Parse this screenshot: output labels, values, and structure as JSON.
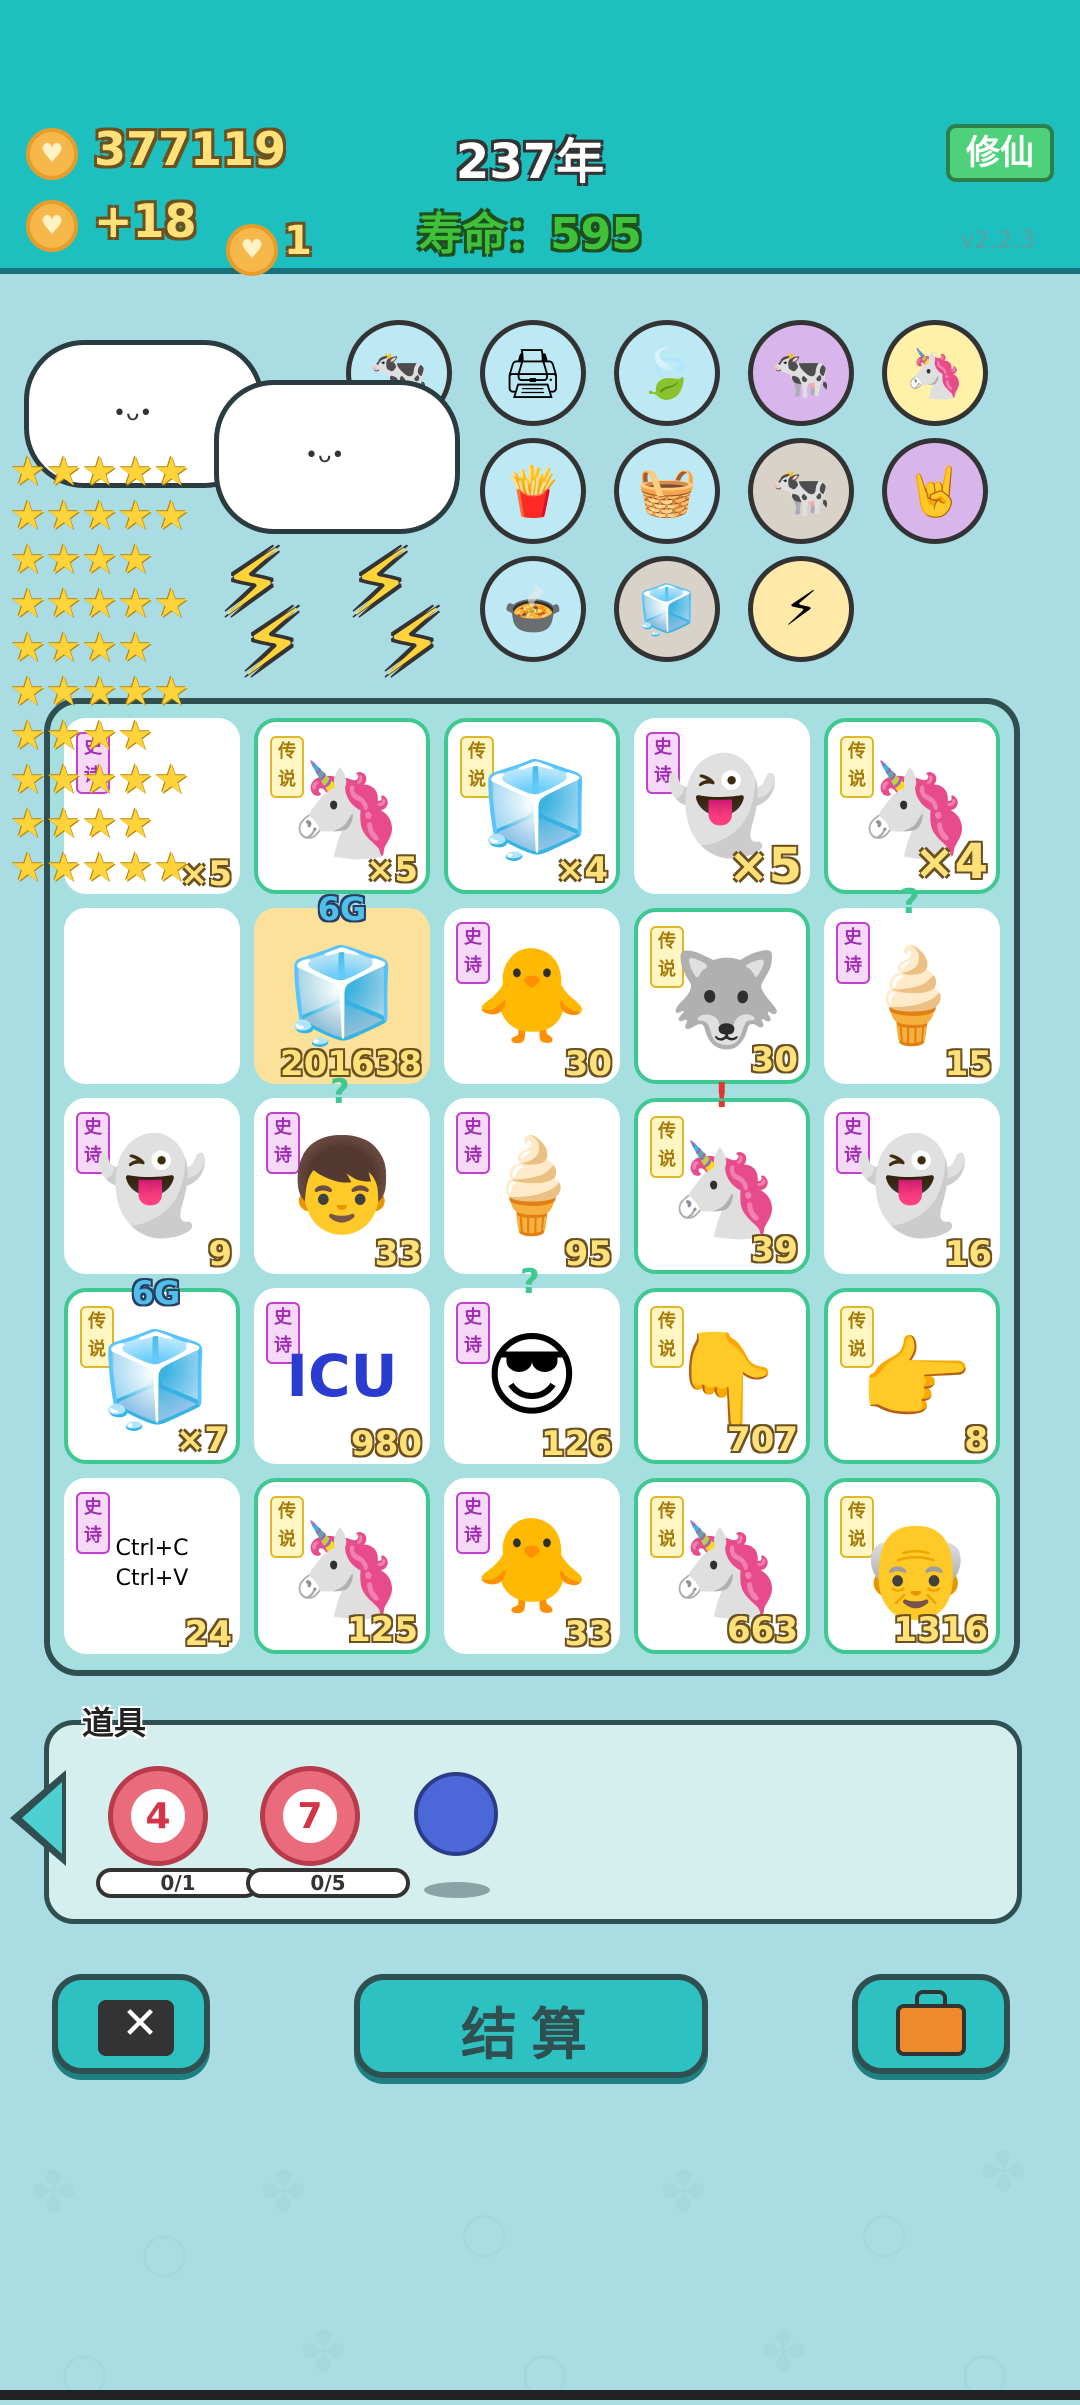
{
  "header": {
    "coins": "377119",
    "income": "+18",
    "floating_coin": "1",
    "year": "237年",
    "life_label": "寿命：",
    "life_value": "595",
    "xiuxian_button": "修仙",
    "version": "v2.2.3"
  },
  "shelf": {
    "symbols": [
      {
        "name": "printer",
        "glyph": "🖨"
      },
      {
        "name": "leaf",
        "glyph": "🍃"
      },
      {
        "name": "cows",
        "glyph": "🐄"
      },
      {
        "name": "unicorn",
        "glyph": "🦄"
      },
      {
        "name": "fries",
        "glyph": "🍟"
      },
      {
        "name": "fruit-basket",
        "glyph": "🧺"
      },
      {
        "name": "cows-2",
        "glyph": "🐄"
      },
      {
        "name": "rock-hand",
        "glyph": "🤘"
      },
      {
        "name": "cooking-pot",
        "glyph": "🍲"
      },
      {
        "name": "sugar-cubes",
        "glyph": "🧊"
      },
      {
        "name": "lightning",
        "glyph": "⚡"
      },
      {
        "name": "cows-3",
        "glyph": "🐄"
      }
    ]
  },
  "board": {
    "cells": [
      {
        "tag": "史诗",
        "glyph": "",
        "value": "×5",
        "big": false,
        "mark": ""
      },
      {
        "tag": "传说",
        "glyph": "🦄",
        "value": "×5",
        "big": false,
        "mark": ""
      },
      {
        "tag": "传说",
        "glyph": "🧊",
        "value": "×4",
        "big": false,
        "mark": ""
      },
      {
        "tag": "史诗",
        "glyph": "👻",
        "value": "×5",
        "big": true,
        "mark": ""
      },
      {
        "tag": "传说",
        "glyph": "🦄",
        "value": "×4",
        "big": true,
        "mark": ""
      },
      {
        "tag": "",
        "glyph": "",
        "value": "",
        "big": false,
        "mark": ""
      },
      {
        "tag": "",
        "glyph": "🧊",
        "value": "201638",
        "big": false,
        "mark": "6G"
      },
      {
        "tag": "史诗",
        "glyph": "🐥",
        "value": "30",
        "big": false,
        "mark": ""
      },
      {
        "tag": "传说",
        "glyph": "🐺",
        "value": "30",
        "big": false,
        "mark": ""
      },
      {
        "tag": "史诗",
        "glyph": "🍦",
        "value": "15",
        "big": false,
        "mark": "?"
      },
      {
        "tag": "史诗",
        "glyph": "👻",
        "value": "9",
        "big": false,
        "mark": ""
      },
      {
        "tag": "史诗",
        "glyph": "👦",
        "value": "33",
        "big": false,
        "mark": "?"
      },
      {
        "tag": "史诗",
        "glyph": "🍦",
        "value": "95",
        "big": false,
        "mark": ""
      },
      {
        "tag": "传说",
        "glyph": "🦄",
        "value": "39",
        "big": false,
        "mark": "!"
      },
      {
        "tag": "史诗",
        "glyph": "👻",
        "value": "16",
        "big": false,
        "mark": ""
      },
      {
        "tag": "传说",
        "glyph": "🧊",
        "value": "×7",
        "big": false,
        "mark": "6G"
      },
      {
        "tag": "史诗",
        "glyph": "ICU",
        "value": "980",
        "big": false,
        "mark": ""
      },
      {
        "tag": "史诗",
        "glyph": "😎",
        "value": "126",
        "big": false,
        "mark": "?"
      },
      {
        "tag": "传说",
        "glyph": "👇",
        "value": "707",
        "big": false,
        "mark": ""
      },
      {
        "tag": "传说",
        "glyph": "👉",
        "value": "8",
        "big": false,
        "mark": ""
      },
      {
        "tag": "史诗",
        "glyph": "Ctrl+C\nCtrl+V",
        "value": "24",
        "big": false,
        "mark": ""
      },
      {
        "tag": "传说",
        "glyph": "🦄",
        "value": "125",
        "big": false,
        "mark": ""
      },
      {
        "tag": "史诗",
        "glyph": "🐥",
        "value": "33",
        "big": false,
        "mark": ""
      },
      {
        "tag": "传说",
        "glyph": "🦄",
        "value": "663",
        "big": false,
        "mark": ""
      },
      {
        "tag": "传说",
        "glyph": "👴",
        "value": "1316",
        "big": false,
        "mark": ""
      }
    ]
  },
  "items": {
    "label": "道具",
    "targets": [
      {
        "number": "4",
        "count": "0/1"
      },
      {
        "number": "7",
        "count": "0/5"
      }
    ]
  },
  "buttons": {
    "settle": "结算"
  },
  "colors": {
    "header_bg": "#1dbfbf",
    "page_bg": "#a9dde3",
    "coin_text": "#ffe17a",
    "life_text": "#3fc23a",
    "epic_tag": "#c23fd2",
    "legend_tag": "#e0b728",
    "highlight_border": "#3fc891"
  }
}
